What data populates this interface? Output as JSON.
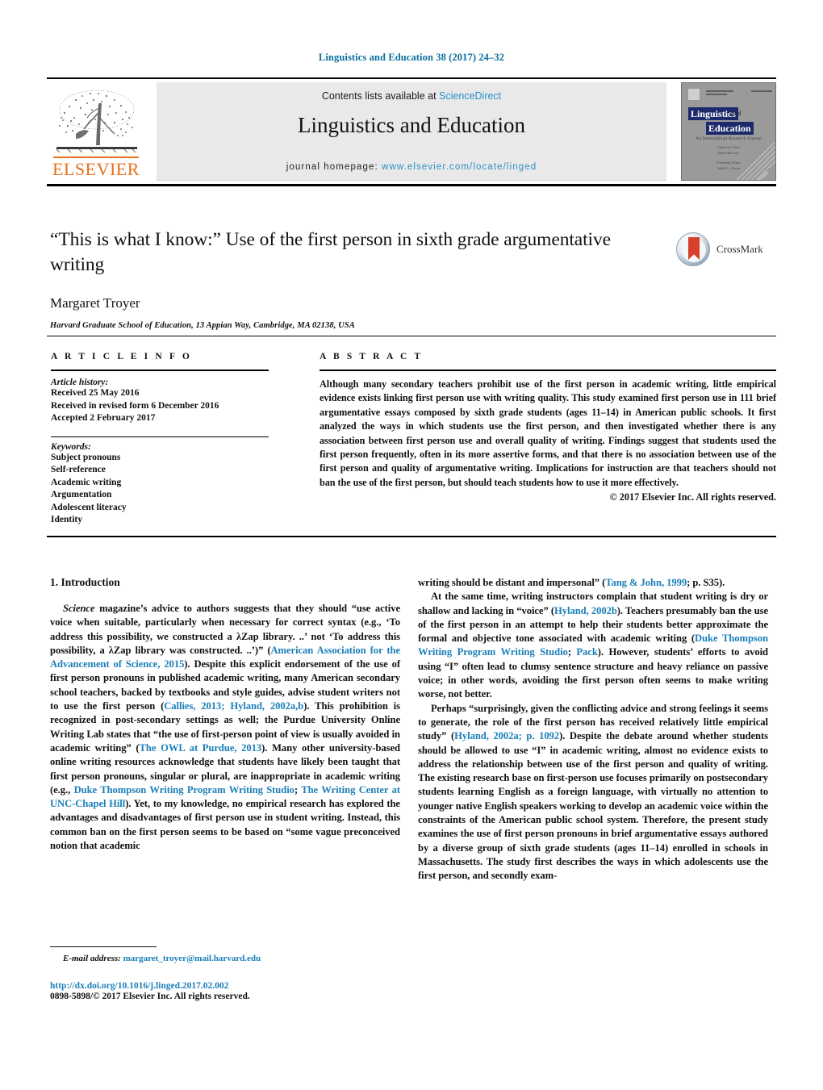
{
  "running_head": "Linguistics and Education 38 (2017) 24–32",
  "masthead": {
    "contents_prefix": "Contents lists available at",
    "contents_link": "ScienceDirect",
    "journal_name": "Linguistics and Education",
    "homepage_prefix": "journal homepage:",
    "homepage_url": "www.elsevier.com/locate/linged",
    "publisher": "ELSEVIER",
    "cover": {
      "title_line1": "Linguistics",
      "title_and": "and",
      "title_line2": "Education",
      "subtitle": "An International Research Journal",
      "meta_lines": "Editor-in-Chief\nDavid Bloome\n\nFounding Editor\nJudith L. Green",
      "spine_publisher": "ELSEVIER"
    }
  },
  "article": {
    "title": "“This is what I know:” Use of the first person in sixth grade argumentative writing",
    "authors": "Margaret Troyer",
    "affiliation": "Harvard Graduate School of Education, 13 Appian Way, Cambridge, MA 02138, USA",
    "crossmark_label": "CrossMark"
  },
  "info": {
    "heading": "A R T I C L E   I N F O",
    "history_label": "Article history:",
    "history": [
      "Received 25 May 2016",
      "Received in revised form 6 December 2016",
      "Accepted 2 February 2017"
    ],
    "keywords_label": "Keywords:",
    "keywords": [
      "Subject pronouns",
      "Self-reference",
      "Academic writing",
      "Argumentation",
      "Adolescent literacy",
      "Identity"
    ]
  },
  "abstract": {
    "heading": "A B S T R A C T",
    "text": "Although many secondary teachers prohibit use of the first person in academic writing, little empirical evidence exists linking first person use with writing quality. This study examined first person use in 111 brief argumentative essays composed by sixth grade students (ages 11–14) in American public schools. It first analyzed the ways in which students use the first person, and then investigated whether there is any association between first person use and overall quality of writing. Findings suggest that students used the first person frequently, often in its more assertive forms, and that there is no association between use of the first person and quality of argumentative writing. Implications for instruction are that teachers should not ban the use of the first person, but should teach students how to use it more effectively.",
    "copyright": "© 2017 Elsevier Inc. All rights reserved."
  },
  "body": {
    "section_title": "1.  Introduction",
    "left": {
      "p1_a": "Science",
      "p1_b": " magazine’s advice to authors suggests that they should “use active voice when suitable, particularly when necessary for correct syntax (e.g., ‘To address this possibility, we constructed a λZap library. ..’ not ‘To address this possibility, a λZap library was constructed. ..’)” (",
      "p1_ref1": "American Association for the Advancement of Science, 2015",
      "p1_c": "). Despite this explicit endorsement of the use of first person pronouns in published academic writing, many American secondary school teachers, backed by textbooks and style guides, advise student writers not to use the first person (",
      "p1_ref2": "Callies, 2013; Hyland, 2002a,b",
      "p1_d": "). This prohibition is recognized in post-secondary settings as well; the Purdue University Online Writing Lab states that “the use of first-person point of view is usually avoided in academic writing” (",
      "p1_ref3": "The OWL at Purdue, 2013",
      "p1_e": "). Many other university-based online writing resources acknowledge that students have likely been taught that first person pronouns, singular or plural, are inappropriate in academic writing (e.g., ",
      "p1_ref4": "Duke Thompson Writing Program Writing Studio",
      "p1_f": "; ",
      "p1_ref5": "The Writing Center at UNC-Chapel Hill",
      "p1_g": "). Yet, to my knowledge, no empirical research has explored the advantages and disadvantages of first person use in student writing. Instead, this common ban on the first person seems to be based on “some vague preconceived notion that academic"
    },
    "right": {
      "p1_cont_a": "writing should be distant and impersonal” (",
      "p1_cont_ref": "Tang & John, 1999",
      "p1_cont_b": "; p. S35).",
      "p2_a": "At the same time, writing instructors complain that student writing is dry or shallow and lacking in “voice” (",
      "p2_ref1": "Hyland, 2002b",
      "p2_b": "). Teachers presumably ban the use of the first person in an attempt to help their students better approximate the formal and objective tone associated with academic writing (",
      "p2_ref2": "Duke Thompson Writing Program Writing Studio",
      "p2_c": "; ",
      "p2_ref3": "Pack",
      "p2_d": "). However, students’ efforts to avoid using “I” often lead to clumsy sentence structure and heavy reliance on passive voice; in other words, avoiding the first person often seems to make writing worse, not better.",
      "p3_a": "Perhaps “surprisingly, given the conflicting advice and strong feelings it seems to generate, the role of the first person has received relatively little empirical study” (",
      "p3_ref1": "Hyland, 2002a; p. 1092",
      "p3_b": "). Despite the debate around whether students should be allowed to use “I” in academic writing, almost no evidence exists to address the relationship between use of the first person and quality of writing. The existing research base on first-person use focuses primarily on postsecondary students learning English as a foreign language, with virtually no attention to younger native English speakers working to develop an academic voice within the constraints of the American public school system. Therefore, the present study examines the use of first person pronouns in brief argumentative essays authored by a diverse group of sixth grade students (ages 11–14) enrolled in schools in Massachusetts. The study first describes the ways in which adolescents use the first person, and secondly exam-"
    }
  },
  "footnote": {
    "label": "E-mail address:",
    "email": "margaret_troyer@mail.harvard.edu"
  },
  "footer": {
    "doi": "http://dx.doi.org/10.1016/j.linged.2017.02.002",
    "issn_line": "0898-5898/© 2017 Elsevier Inc. All rights reserved."
  },
  "colors": {
    "link": "#1b7fb8",
    "running_head": "#0b6e9e",
    "elsevier_orange": "#E8701A",
    "sciencedirect": "#2b8fc9",
    "cover_navy": "#1c2a6b",
    "crossmark_red": "#d8402e"
  }
}
